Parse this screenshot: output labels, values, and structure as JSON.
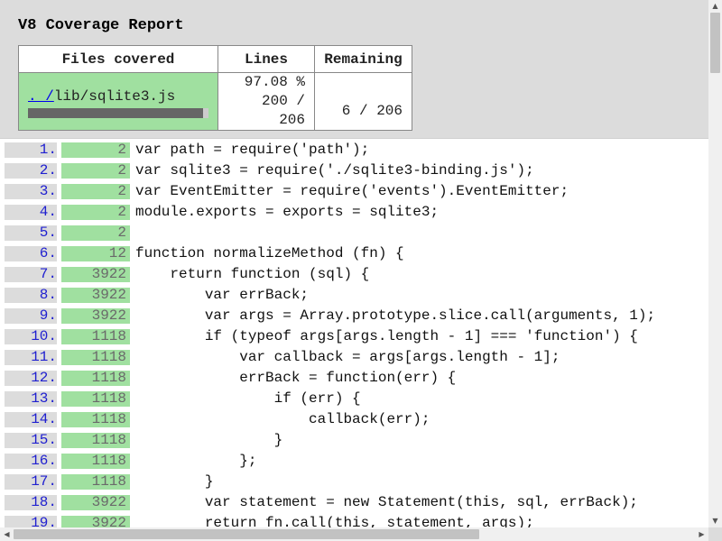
{
  "report": {
    "title": "V8 Coverage Report",
    "headers": {
      "files": "Files covered",
      "lines": "Lines",
      "remaining": "Remaining"
    },
    "file": {
      "root_link": ". /",
      "path": "lib/sqlite3.js",
      "coverage_fraction": 0.9708
    },
    "lines_percent": "97.08 %",
    "lines_count": "200 / 206",
    "remaining_count": "6 / 206"
  },
  "code_lines": [
    {
      "n": "1.",
      "hits": "2",
      "src": "var path = require('path');"
    },
    {
      "n": "2.",
      "hits": "2",
      "src": "var sqlite3 = require('./sqlite3-binding.js');"
    },
    {
      "n": "3.",
      "hits": "2",
      "src": "var EventEmitter = require('events').EventEmitter;"
    },
    {
      "n": "4.",
      "hits": "2",
      "src": "module.exports = exports = sqlite3;"
    },
    {
      "n": "5.",
      "hits": "2",
      "src": ""
    },
    {
      "n": "6.",
      "hits": "12",
      "src": "function normalizeMethod (fn) {"
    },
    {
      "n": "7.",
      "hits": "3922",
      "src": "    return function (sql) {"
    },
    {
      "n": "8.",
      "hits": "3922",
      "src": "        var errBack;"
    },
    {
      "n": "9.",
      "hits": "3922",
      "src": "        var args = Array.prototype.slice.call(arguments, 1);"
    },
    {
      "n": "10.",
      "hits": "1118",
      "src": "        if (typeof args[args.length - 1] === 'function') {"
    },
    {
      "n": "11.",
      "hits": "1118",
      "src": "            var callback = args[args.length - 1];"
    },
    {
      "n": "12.",
      "hits": "1118",
      "src": "            errBack = function(err) {"
    },
    {
      "n": "13.",
      "hits": "1118",
      "src": "                if (err) {"
    },
    {
      "n": "14.",
      "hits": "1118",
      "src": "                    callback(err);"
    },
    {
      "n": "15.",
      "hits": "1118",
      "src": "                }"
    },
    {
      "n": "16.",
      "hits": "1118",
      "src": "            };"
    },
    {
      "n": "17.",
      "hits": "1118",
      "src": "        }"
    },
    {
      "n": "18.",
      "hits": "3922",
      "src": "        var statement = new Statement(this, sql, errBack);"
    },
    {
      "n": "19.",
      "hits": "3922",
      "src": "        return fn.call(this, statement, args);"
    }
  ],
  "icons": {
    "scroll_up": "▲",
    "scroll_down": "▼",
    "scroll_left": "◀",
    "scroll_right": "▶"
  },
  "colors": {
    "covered_green": "#a0e0a0",
    "header_gray": "#dcdcdc",
    "line_number_blue": "#2020d0"
  }
}
